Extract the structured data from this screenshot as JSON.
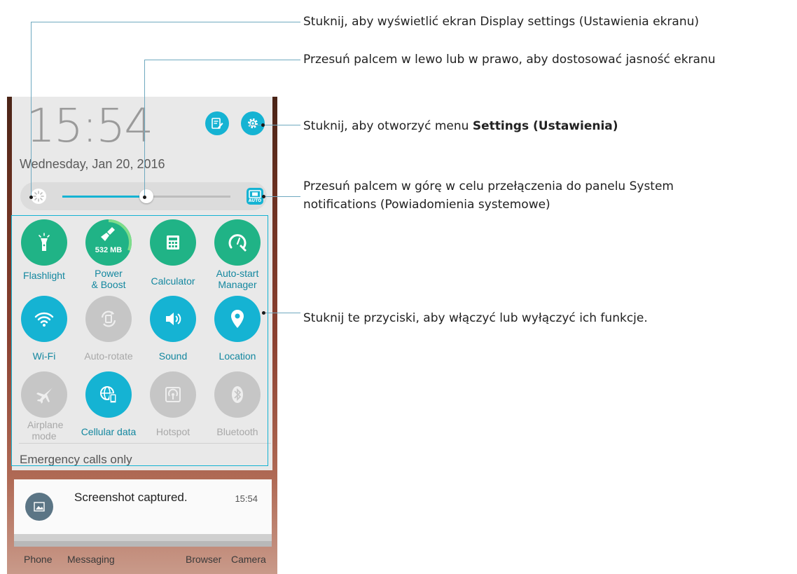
{
  "phone": {
    "time": "15:54",
    "date": "Wednesday, Jan 20, 2016",
    "brightness": {
      "level": 0.5,
      "auto_label": "AUTO"
    },
    "tiles": [
      {
        "id": "flashlight",
        "label": "Flashlight",
        "state": "on",
        "icon": "flashlight-icon"
      },
      {
        "id": "power-boost",
        "label": "Power & Boost",
        "state": "on",
        "icon": "broom-icon",
        "badge": "532 MB"
      },
      {
        "id": "calculator",
        "label": "Calculator",
        "state": "on",
        "icon": "calculator-icon"
      },
      {
        "id": "auto-start",
        "label": "Auto-start Manager",
        "state": "on",
        "icon": "gauge-wrench-icon"
      },
      {
        "id": "wifi",
        "label": "Wi-Fi",
        "state": "active",
        "icon": "wifi-icon"
      },
      {
        "id": "auto-rotate",
        "label": "Auto-rotate",
        "state": "off",
        "icon": "rotate-icon"
      },
      {
        "id": "sound",
        "label": "Sound",
        "state": "active",
        "icon": "speaker-icon"
      },
      {
        "id": "location",
        "label": "Location",
        "state": "active",
        "icon": "location-pin-icon"
      },
      {
        "id": "airplane",
        "label": "Airplane mode",
        "state": "off",
        "icon": "airplane-icon"
      },
      {
        "id": "cellular",
        "label": "Cellular data",
        "state": "active",
        "icon": "globe-phone-icon"
      },
      {
        "id": "hotspot",
        "label": "Hotspot",
        "state": "off",
        "icon": "hotspot-icon"
      },
      {
        "id": "bluetooth",
        "label": "Bluetooth",
        "state": "off",
        "icon": "bluetooth-icon"
      }
    ],
    "emergency": "Emergency calls only",
    "notification": {
      "title": "Screenshot captured.",
      "time": "15:54"
    },
    "dock": [
      "Phone",
      "Messaging",
      "Browser",
      "Camera"
    ]
  },
  "annotations": {
    "display": "Stuknij, aby wyświetlić ekran Display settings (Ustawienia ekranu)",
    "brightness": "Przesuń palcem w lewo lub w prawo, aby dostosować jasność ekranu",
    "settings_prefix": "Stuknij, aby otworzyć menu ",
    "settings_bold": "Settings (Ustawienia)",
    "swipe_line1": "Przesuń palcem w górę w celu przełączenia do panelu System",
    "swipe_line2": "notifications (Powiadomienia systemowe)",
    "toggles": "Stuknij te przyciski, aby włączyć lub wyłączyć ich funkcje."
  },
  "colors": {
    "accent": "#15b3d3",
    "green": "#20b386",
    "off": "#c6c6c6"
  }
}
